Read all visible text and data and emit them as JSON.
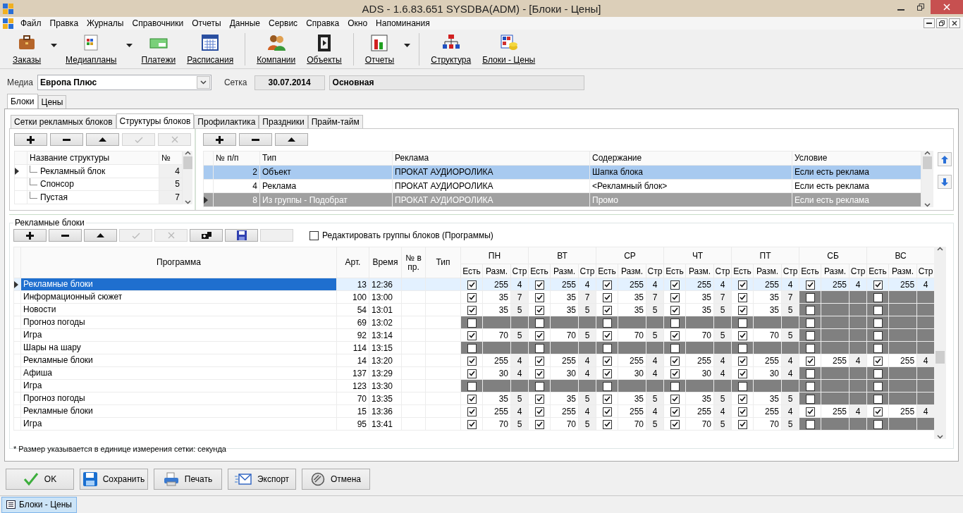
{
  "window": {
    "title": "ADS - 1.6.83.651 SYSDBA(ADM) - [Блоки - Цены]"
  },
  "menu": [
    "Файл",
    "Правка",
    "Журналы",
    "Справочники",
    "Отчеты",
    "Данные",
    "Сервис",
    "Справка",
    "Окно",
    "Напоминания"
  ],
  "toolbar": {
    "groups": [
      [
        {
          "label": "Заказы",
          "dropdown": true
        },
        {
          "label": "Медиапланы",
          "dropdown": true
        },
        {
          "label": "Платежи",
          "dropdown": false
        },
        {
          "label": "Расписания",
          "dropdown": false
        }
      ],
      [
        {
          "label": "Компании",
          "dropdown": false
        },
        {
          "label": "Объекты",
          "dropdown": false
        }
      ],
      [
        {
          "label": "Отчеты",
          "dropdown": true
        }
      ],
      [
        {
          "label": "Структура",
          "dropdown": false
        },
        {
          "label": "Блоки - Цены",
          "dropdown": false
        }
      ]
    ]
  },
  "filter": {
    "media_label": "Медиа",
    "media_value": "Европа Плюс",
    "grid_label": "Сетка",
    "grid_date": "30.07.2014",
    "grid_name": "Основная"
  },
  "tabs": [
    {
      "label": "Блоки",
      "selected": true
    },
    {
      "label": "Цены",
      "selected": false
    }
  ],
  "subtabs": [
    {
      "label": "Сетки рекламных блоков",
      "selected": false
    },
    {
      "label": "Структуры блоков",
      "selected": true
    },
    {
      "label": "Профилактика",
      "selected": false
    },
    {
      "label": "Праздники",
      "selected": false
    },
    {
      "label": "Прайм-тайм",
      "selected": false
    }
  ],
  "structures": {
    "toolbar": [
      {
        "disabled": false
      },
      {
        "disabled": false
      },
      {
        "disabled": false
      },
      {
        "disabled": true
      },
      {
        "disabled": true
      }
    ],
    "columns": [
      "Название структуры",
      "№"
    ],
    "rows": [
      {
        "name": "Рекламный блок",
        "number": "4",
        "current": true
      },
      {
        "name": "Спонсор",
        "number": "5",
        "current": false
      },
      {
        "name": "Пустая",
        "number": "7",
        "current": false
      }
    ]
  },
  "structure_items": {
    "toolbar": [
      {
        "disabled": false
      },
      {
        "disabled": false
      },
      {
        "disabled": false
      }
    ],
    "columns": [
      "№ п/п",
      "Тип",
      "Реклама",
      "Содержание",
      "Условие"
    ],
    "rows": [
      {
        "cells": [
          "2",
          "Объект",
          "ПРОКАТ АУДИОРОЛИКА",
          "Шапка блока",
          "Если есть реклама"
        ],
        "selected": true,
        "current": false
      },
      {
        "cells": [
          "4",
          "Реклама",
          "ПРОКАТ АУДИОРОЛИКА",
          "<Рекламный блок>",
          "Если есть реклама"
        ],
        "selected": false,
        "current": false
      },
      {
        "cells": [
          "8",
          "Из группы - Подобрат",
          "ПРОКАТ АУДИОРОЛИКА",
          "Промо",
          "Если есть реклама"
        ],
        "selected": false,
        "current": true
      }
    ]
  },
  "ad_blocks": {
    "title": "Рекламные блоки",
    "toolbar": [
      {
        "disabled": false
      },
      {
        "disabled": false
      },
      {
        "disabled": false
      },
      {
        "disabled": true
      },
      {
        "disabled": true
      },
      {
        "disabled": false
      },
      {
        "disabled": false
      },
      {
        "disabled": true
      }
    ],
    "edit_groups": {
      "label": "Редактировать группы блоков (Программы)",
      "checked": false
    },
    "columns": [
      "Программа",
      "Арт.",
      "Время",
      "№ в пр.",
      "Тип"
    ],
    "days": [
      {
        "label": "ПН",
        "columns": [
          "Есть",
          "Разм.",
          "Стр"
        ]
      },
      {
        "label": "ВТ",
        "columns": [
          "Есть",
          "Разм.",
          "Стр"
        ]
      },
      {
        "label": "СР",
        "columns": [
          "Есть",
          "Разм.",
          "Стр"
        ]
      },
      {
        "label": "ЧТ",
        "columns": [
          "Есть",
          "Разм.",
          "Стр"
        ]
      },
      {
        "label": "ПТ",
        "columns": [
          "Есть",
          "Разм.",
          "Стр"
        ]
      },
      {
        "label": "СБ",
        "columns": [
          "Есть",
          "Разм.",
          "Стр"
        ]
      },
      {
        "label": "ВС",
        "columns": [
          "Есть",
          "Разм.",
          "Стр"
        ]
      }
    ],
    "rows": [
      {
        "program": "Рекламные блоки",
        "art": "13",
        "time": "12:36",
        "selected": true,
        "days": [
          {
            "present": true,
            "size": "255",
            "pages": "4"
          },
          {
            "present": true,
            "size": "255",
            "pages": "4"
          },
          {
            "present": true,
            "size": "255",
            "pages": "4"
          },
          {
            "present": true,
            "size": "255",
            "pages": "4"
          },
          {
            "present": true,
            "size": "255",
            "pages": "4"
          },
          {
            "present": true,
            "size": "255",
            "pages": "4"
          },
          {
            "present": true,
            "size": "255",
            "pages": "4"
          }
        ]
      },
      {
        "program": "Информационный сюжет",
        "art": "100",
        "time": "13:00",
        "selected": false,
        "days": [
          {
            "present": true,
            "size": "35",
            "pages": "7"
          },
          {
            "present": true,
            "size": "35",
            "pages": "7"
          },
          {
            "present": true,
            "size": "35",
            "pages": "7"
          },
          {
            "present": true,
            "size": "35",
            "pages": "7"
          },
          {
            "present": true,
            "size": "35",
            "pages": "7"
          },
          {
            "present": false
          },
          {
            "present": false
          }
        ]
      },
      {
        "program": "Новости",
        "art": "54",
        "time": "13:01",
        "selected": false,
        "days": [
          {
            "present": true,
            "size": "35",
            "pages": "5"
          },
          {
            "present": true,
            "size": "35",
            "pages": "5"
          },
          {
            "present": true,
            "size": "35",
            "pages": "5"
          },
          {
            "present": true,
            "size": "35",
            "pages": "5"
          },
          {
            "present": true,
            "size": "35",
            "pages": "5"
          },
          {
            "present": false
          },
          {
            "present": false
          }
        ]
      },
      {
        "program": "Прогноз погоды",
        "art": "69",
        "time": "13:02",
        "selected": false,
        "days": [
          {
            "present": false
          },
          {
            "present": false
          },
          {
            "present": false
          },
          {
            "present": false
          },
          {
            "present": false
          },
          {
            "present": false
          },
          {
            "present": false
          }
        ]
      },
      {
        "program": "Игра",
        "art": "92",
        "time": "13:14",
        "selected": false,
        "days": [
          {
            "present": true,
            "size": "70",
            "pages": "5"
          },
          {
            "present": true,
            "size": "70",
            "pages": "5"
          },
          {
            "present": true,
            "size": "70",
            "pages": "5"
          },
          {
            "present": true,
            "size": "70",
            "pages": "5"
          },
          {
            "present": true,
            "size": "70",
            "pages": "5"
          },
          {
            "present": false
          },
          {
            "present": false
          }
        ]
      },
      {
        "program": "Шары на шару",
        "art": "114",
        "time": "13:15",
        "selected": false,
        "days": [
          {
            "present": false
          },
          {
            "present": false
          },
          {
            "present": false
          },
          {
            "present": false
          },
          {
            "present": false
          },
          {
            "present": false
          },
          {
            "present": false
          }
        ]
      },
      {
        "program": "Рекламные блоки",
        "art": "14",
        "time": "13:20",
        "selected": false,
        "days": [
          {
            "present": true,
            "size": "255",
            "pages": "4"
          },
          {
            "present": true,
            "size": "255",
            "pages": "4"
          },
          {
            "present": true,
            "size": "255",
            "pages": "4"
          },
          {
            "present": true,
            "size": "255",
            "pages": "4"
          },
          {
            "present": true,
            "size": "255",
            "pages": "4"
          },
          {
            "present": true,
            "size": "255",
            "pages": "4"
          },
          {
            "present": true,
            "size": "255",
            "pages": "4"
          }
        ]
      },
      {
        "program": "Афиша",
        "art": "137",
        "time": "13:29",
        "selected": false,
        "days": [
          {
            "present": true,
            "size": "30",
            "pages": "4"
          },
          {
            "present": true,
            "size": "30",
            "pages": "4"
          },
          {
            "present": true,
            "size": "30",
            "pages": "4"
          },
          {
            "present": true,
            "size": "30",
            "pages": "4"
          },
          {
            "present": true,
            "size": "30",
            "pages": "4"
          },
          {
            "present": false
          },
          {
            "present": false
          }
        ]
      },
      {
        "program": "Игра",
        "art": "123",
        "time": "13:30",
        "selected": false,
        "days": [
          {
            "present": false
          },
          {
            "present": false
          },
          {
            "present": false
          },
          {
            "present": false
          },
          {
            "present": false
          },
          {
            "present": false
          },
          {
            "present": false
          }
        ]
      },
      {
        "program": "Прогноз погоды",
        "art": "70",
        "time": "13:35",
        "selected": false,
        "days": [
          {
            "present": true,
            "size": "35",
            "pages": "5"
          },
          {
            "present": true,
            "size": "35",
            "pages": "5"
          },
          {
            "present": true,
            "size": "35",
            "pages": "5"
          },
          {
            "present": true,
            "size": "35",
            "pages": "5"
          },
          {
            "present": true,
            "size": "35",
            "pages": "5"
          },
          {
            "present": false
          },
          {
            "present": false
          }
        ]
      },
      {
        "program": "Рекламные блоки",
        "art": "15",
        "time": "13:36",
        "selected": false,
        "days": [
          {
            "present": true,
            "size": "255",
            "pages": "4"
          },
          {
            "present": true,
            "size": "255",
            "pages": "4"
          },
          {
            "present": true,
            "size": "255",
            "pages": "4"
          },
          {
            "present": true,
            "size": "255",
            "pages": "4"
          },
          {
            "present": true,
            "size": "255",
            "pages": "4"
          },
          {
            "present": true,
            "size": "255",
            "pages": "4"
          },
          {
            "present": true,
            "size": "255",
            "pages": "4"
          }
        ]
      },
      {
        "program": "Игра",
        "art": "95",
        "time": "13:41",
        "selected": false,
        "days": [
          {
            "present": true,
            "size": "70",
            "pages": "5"
          },
          {
            "present": true,
            "size": "70",
            "pages": "5"
          },
          {
            "present": true,
            "size": "70",
            "pages": "5"
          },
          {
            "present": true,
            "size": "70",
            "pages": "5"
          },
          {
            "present": true,
            "size": "70",
            "pages": "5"
          },
          {
            "present": false
          },
          {
            "present": false
          }
        ]
      }
    ],
    "footnote": "* Размер указывается в единице измерения сетки: секунда"
  },
  "buttons": [
    "OK",
    "Сохранить",
    "Печать",
    "Экспорт",
    "Отмена"
  ],
  "taskbar": [
    {
      "label": "Блоки - Цены",
      "selected": true
    }
  ]
}
